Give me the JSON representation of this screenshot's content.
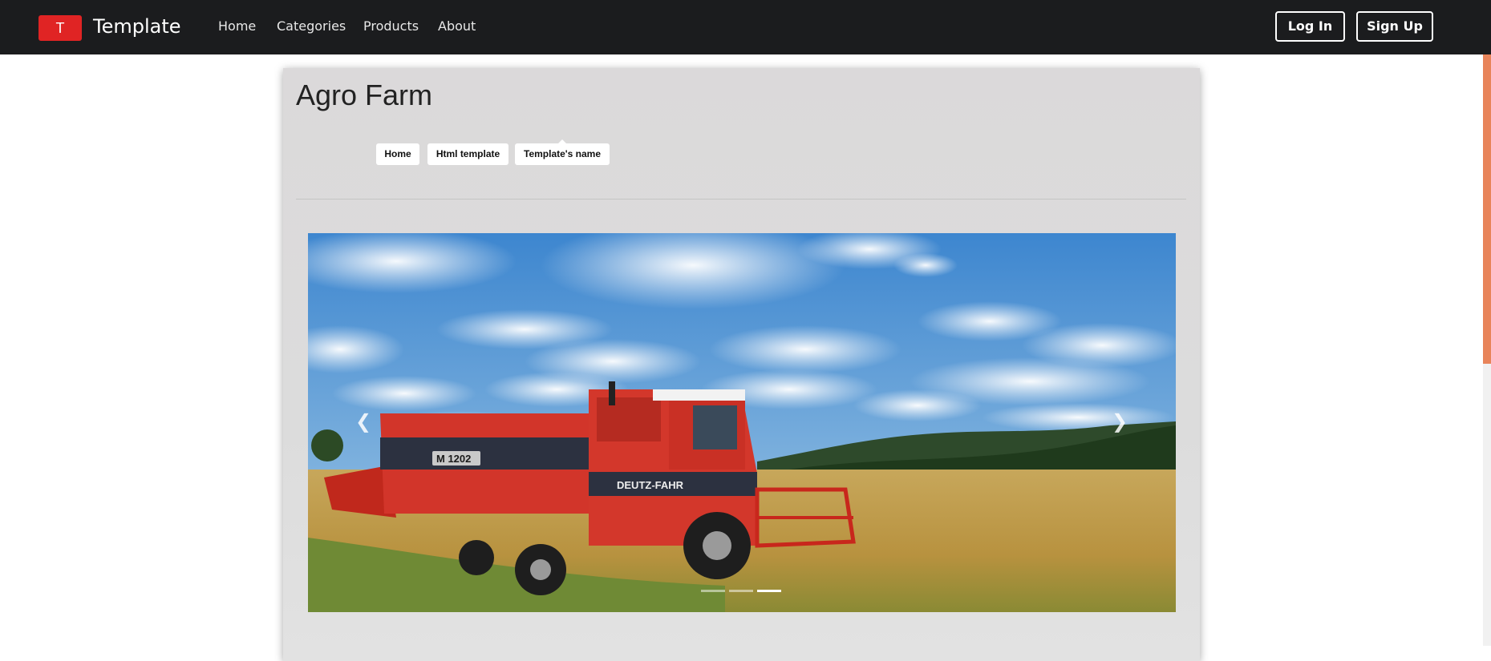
{
  "navbar": {
    "brand_letter": "T",
    "brand_name": "Template",
    "links": [
      "Home",
      "Categories",
      "Products",
      "About"
    ],
    "login_label": "Log In",
    "signup_label": "Sign Up"
  },
  "main": {
    "title": "Agro Farm",
    "breadcrumbs": [
      "Home",
      "Html template",
      "Template's name"
    ]
  },
  "carousel": {
    "slide_count": 3,
    "active_index": 2,
    "prev_icon": "chevron-left-icon",
    "next_icon": "chevron-right-icon",
    "vehicle_labels": [
      "M 1202",
      "DEUTZ-FAHR"
    ]
  },
  "colors": {
    "navbar": "#1b1c1e",
    "brand_red": "#e02424",
    "panel": "#dcdcdc",
    "scroll_thumb": "#e8845a"
  }
}
